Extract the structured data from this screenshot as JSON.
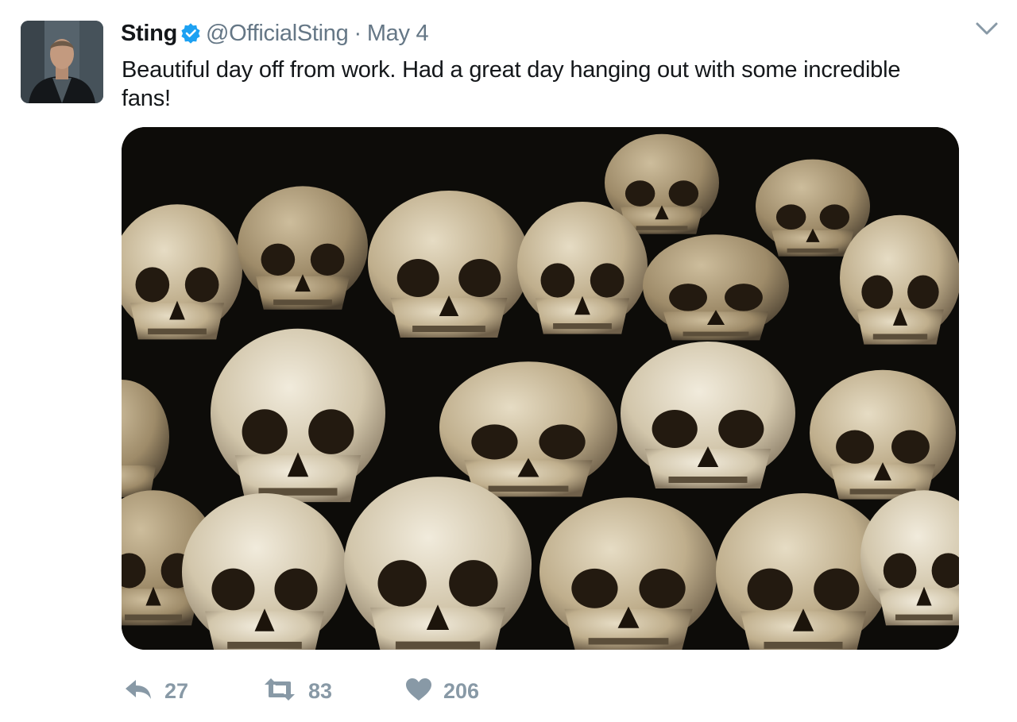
{
  "tweet": {
    "author": {
      "name": "Sting",
      "handle": "@OfficialSting",
      "verified": true
    },
    "separator": "·",
    "date": "May 4",
    "text": "Beautiful day off from work. Had a great day hanging out with some incredible fans!",
    "media_alt": "Photo of a pile of human skulls",
    "actions": {
      "replies": "27",
      "retweets": "83",
      "likes": "206"
    }
  },
  "icons": {
    "verified": "verified-badge-icon",
    "caret": "chevron-down-icon",
    "reply": "reply-icon",
    "retweet": "retweet-icon",
    "like": "heart-icon"
  },
  "colors": {
    "text": "#14171a",
    "secondary": "#657786",
    "action": "#8899a6",
    "verified": "#1da1f2"
  }
}
